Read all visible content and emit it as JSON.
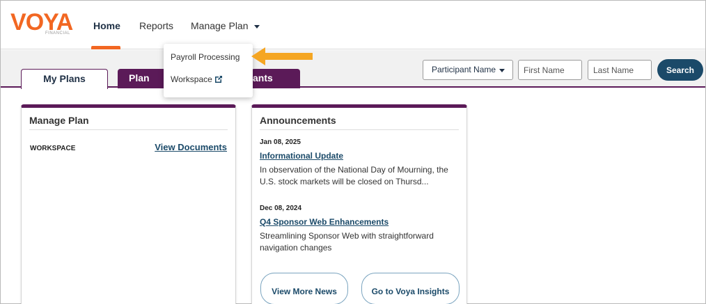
{
  "brand": {
    "logo_text_v": "V",
    "logo_text_o": "O",
    "logo_text_ya": "YA",
    "logo_sub": "FINANCIAL",
    "colors": {
      "primary_purple": "#5b1a58",
      "accent_orange": "#f26722",
      "link_blue": "#1b4a69",
      "arrow_yellow": "#f5a623"
    }
  },
  "nav": {
    "home": "Home",
    "reports": "Reports",
    "manage_plan": "Manage Plan",
    "caret_icon": "chevron-down-icon"
  },
  "dropdown": {
    "payroll": "Payroll Processing",
    "workspace": "Workspace",
    "external_icon": "external-link-icon"
  },
  "tabs": {
    "my_plans": "My Plans",
    "plan_summary": "Plan Summary",
    "participants": "Participants",
    "participants_visible": "ants"
  },
  "search": {
    "select_value": "Participant Name",
    "first_placeholder": "First Name",
    "last_placeholder": "Last Name",
    "button": "Search"
  },
  "manage_card": {
    "title": "Manage Plan",
    "workspace_label": "WORKSPACE",
    "view_documents": "View Documents"
  },
  "announcements": {
    "title": "Announcements",
    "items": [
      {
        "date": "Jan 08, 2025",
        "title": "Informational Update",
        "body": "In observation of the National Day of Mourning, the U.S. stock markets will be closed on Thursd..."
      },
      {
        "date": "Dec 08, 2024",
        "title": "Q4 Sponsor Web Enhancements",
        "body": "Streamlining Sponsor Web with straightforward navigation changes"
      }
    ],
    "more_news": "View More News",
    "insights": "Go to Voya Insights"
  }
}
